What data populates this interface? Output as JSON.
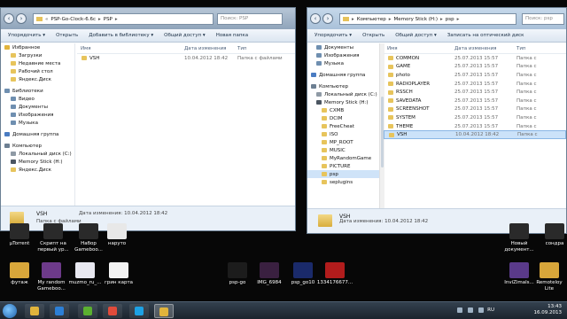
{
  "left_window": {
    "address": [
      "PSP-Go-Clock-6.6c",
      "PSP"
    ],
    "search_placeholder": "Поиск: PSP",
    "toolbar": [
      "Упорядочить ▾",
      "Открыть",
      "Добавить в библиотеку ▾",
      "Общий доступ ▾",
      "Новая папка"
    ],
    "nav": [
      {
        "label": "Избранное",
        "icon": "star",
        "group_start": false
      },
      {
        "label": "Загрузки",
        "icon": "folder",
        "indent": true
      },
      {
        "label": "Недавние места",
        "icon": "folder",
        "indent": true
      },
      {
        "label": "Рабочий стол",
        "icon": "folder",
        "indent": true
      },
      {
        "label": "Яндекс.Диск",
        "icon": "folder",
        "indent": true
      },
      {
        "label": "Библиотеки",
        "icon": "lib",
        "group_start": true
      },
      {
        "label": "Видео",
        "icon": "lib",
        "indent": true
      },
      {
        "label": "Документы",
        "icon": "lib",
        "indent": true
      },
      {
        "label": "Изображения",
        "icon": "lib",
        "indent": true
      },
      {
        "label": "Музыка",
        "icon": "lib",
        "indent": true
      },
      {
        "label": "Домашняя группа",
        "icon": "home",
        "group_start": true
      },
      {
        "label": "Компьютер",
        "icon": "pc",
        "group_start": true
      },
      {
        "label": "Локальный диск (C:)",
        "icon": "drive",
        "indent": true
      },
      {
        "label": "Memory Stick (H:)",
        "icon": "disk",
        "indent": true
      },
      {
        "label": "Яндекс.Диск",
        "icon": "folder",
        "indent": true
      }
    ],
    "columns": {
      "name": "Имя",
      "date": "Дата изменения",
      "type": "Тип"
    },
    "rows": [
      {
        "name": "VSH",
        "date": "10.04.2012 18:42",
        "type": "Папка с файлами",
        "selected": false
      }
    ],
    "details": {
      "name": "VSH",
      "type": "Папка с файлами",
      "date": "Дата изменения: 10.04.2012 18:42"
    }
  },
  "right_window": {
    "address": [
      "Компьютер",
      "Memory Stick (H:)",
      "psp"
    ],
    "search_placeholder": "Поиск: psp",
    "toolbar": [
      "Упорядочить ▾",
      "Открыть",
      "Общий доступ ▾",
      "Записать на оптический диск"
    ],
    "nav": [
      {
        "label": "Документы",
        "icon": "lib",
        "indent": 1
      },
      {
        "label": "Изображения",
        "icon": "lib",
        "indent": 1
      },
      {
        "label": "Музыка",
        "icon": "lib",
        "indent": 1
      },
      {
        "label": "Домашняя группа",
        "icon": "home",
        "indent": 0,
        "group_start": true
      },
      {
        "label": "Компьютер",
        "icon": "pc",
        "indent": 0,
        "group_start": true
      },
      {
        "label": "Локальный диск (C:)",
        "icon": "drive",
        "indent": 1
      },
      {
        "label": "Memory Stick (H:)",
        "icon": "disk",
        "indent": 1
      },
      {
        "label": "CXMB",
        "icon": "folder",
        "indent": 2
      },
      {
        "label": "DCIM",
        "icon": "folder",
        "indent": 2
      },
      {
        "label": "FreeCheat",
        "icon": "folder",
        "indent": 2
      },
      {
        "label": "ISO",
        "icon": "folder",
        "indent": 2
      },
      {
        "label": "MP_ROOT",
        "icon": "folder",
        "indent": 2
      },
      {
        "label": "MUSIC",
        "icon": "folder",
        "indent": 2
      },
      {
        "label": "MyRandomGame",
        "icon": "folder",
        "indent": 2
      },
      {
        "label": "PICTURE",
        "icon": "folder",
        "indent": 2
      },
      {
        "label": "psp",
        "icon": "folder",
        "indent": 2,
        "selected": true
      },
      {
        "label": "seplugins",
        "icon": "folder",
        "indent": 2
      }
    ],
    "columns": {
      "name": "Имя",
      "date": "Дата изменения",
      "type": "Тип"
    },
    "rows": [
      {
        "name": "COMMON",
        "date": "25.07.2013 15:57",
        "type": "Папка с"
      },
      {
        "name": "GAME",
        "date": "25.07.2013 15:57",
        "type": "Папка с"
      },
      {
        "name": "photo",
        "date": "25.07.2013 15:57",
        "type": "Папка с"
      },
      {
        "name": "RADIOPLAYER",
        "date": "25.07.2013 15:57",
        "type": "Папка с"
      },
      {
        "name": "RSSCH",
        "date": "25.07.2013 15:57",
        "type": "Папка с"
      },
      {
        "name": "SAVEDATA",
        "date": "25.07.2013 15:57",
        "type": "Папка с"
      },
      {
        "name": "SCREENSHOT",
        "date": "25.07.2013 15:57",
        "type": "Папка с"
      },
      {
        "name": "SYSTEM",
        "date": "25.07.2013 15:57",
        "type": "Папка с"
      },
      {
        "name": "THEME",
        "date": "25.07.2013 15:57",
        "type": "Папка с"
      },
      {
        "name": "VSH",
        "date": "10.04.2012 18:42",
        "type": "Папка с",
        "selected": true
      }
    ],
    "details": {
      "name": "VSH",
      "type": "Папка с файлами",
      "date": "Дата изменения: 10.04.2012 18:42"
    }
  },
  "desktop_icons_row1": [
    {
      "label": "µTorrent",
      "color": "#2a2a2a"
    },
    {
      "label": "Скрипт на\nпервый ур...",
      "color": "#2a2a2a"
    },
    {
      "label": "Набор\nGameboo...",
      "color": "#2a2a2a"
    },
    {
      "label": "наруто",
      "color": "#e8e8e8"
    },
    {
      "label": "Новый\nдокумент...",
      "color": "#2a2a2a"
    },
    {
      "label": "сондра",
      "color": "#2a2a2a"
    }
  ],
  "desktop_icons_row2": [
    {
      "label": "футаж",
      "color": "#d8a63a"
    },
    {
      "label": "My random\nGameboo...",
      "color": "#6d3a8a"
    },
    {
      "label": "muzmo_ru_...",
      "color": "#e8e8f0"
    },
    {
      "label": "грин карта",
      "color": "#f2f2f2"
    },
    {
      "label": "psp-go",
      "color": "#1c1c1c"
    },
    {
      "label": "IMG_6984",
      "color": "#3a2040"
    },
    {
      "label": "psp_go10",
      "color": "#1a2a6a"
    },
    {
      "label": "1334176677...",
      "color": "#b11c1c"
    },
    {
      "label": "InviZimals...",
      "color": "#5a3a8a"
    },
    {
      "label": "Remoteloy\nLite",
      "color": "#d8a63a"
    }
  ],
  "taskbar": {
    "apps": [
      {
        "name": "explorer",
        "color": "#e1b43c",
        "active": false
      },
      {
        "name": "mediaplayer",
        "color": "#2c7fd6",
        "active": false
      },
      {
        "name": "utorrent",
        "color": "#5bb030",
        "active": false
      },
      {
        "name": "chrome",
        "color": "#e04b3b",
        "active": false
      },
      {
        "name": "skype",
        "color": "#1da1e4",
        "active": false
      },
      {
        "name": "explorer-window",
        "color": "#e1b43c",
        "active": true
      }
    ],
    "lang": "RU",
    "time": "13:43",
    "date": "16.09.2013"
  }
}
